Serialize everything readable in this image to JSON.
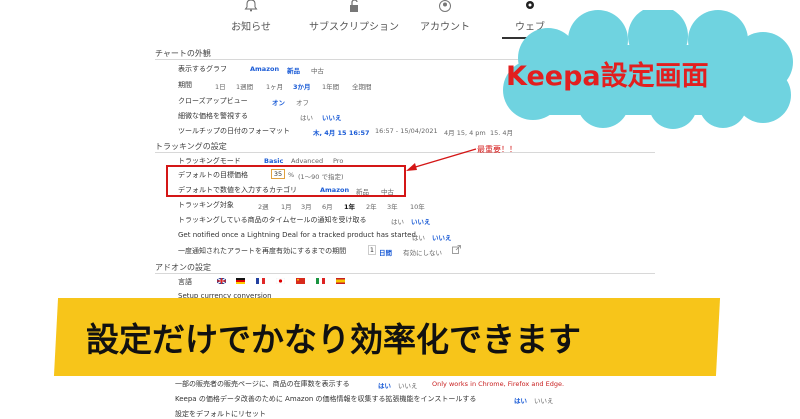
{
  "nav": {
    "items": [
      {
        "label": "お知らせ",
        "icon": "bell-icon"
      },
      {
        "label": "サブスクリプション",
        "icon": "unlock-icon"
      },
      {
        "label": "アカウント",
        "icon": "user-icon"
      },
      {
        "label": "ウェブ",
        "icon": "gear-icon"
      }
    ]
  },
  "chart_appearance": {
    "title": "チャートの外観",
    "graph": {
      "label": "表示するグラフ",
      "options": [
        "Amazon",
        "新品",
        "中古"
      ]
    },
    "period": {
      "label": "期間",
      "options": [
        "1日",
        "1週間",
        "1ヶ月",
        "3か月",
        "1年間",
        "全期間"
      ]
    },
    "closeup": {
      "label": "クローズアップビュー",
      "options": [
        "オン",
        "オフ"
      ]
    },
    "minute": {
      "label": "細微な価格を警視する",
      "options": [
        "はい",
        "いいえ"
      ]
    },
    "tooltip": {
      "label": "ツールチップの日付のフォーマット",
      "options": [
        "木, 4月 15 16:57",
        "16:57 - 15/04/2021",
        "4月 15, 4 pm",
        "15. 4月"
      ]
    }
  },
  "tracking": {
    "title": "トラッキングの設定",
    "mode": {
      "label": "トラッキングモード",
      "options": [
        "Basic",
        "Advanced",
        "Pro"
      ]
    },
    "target_price": {
      "label": "デフォルトの目標価格",
      "value": "35",
      "unit": "%",
      "hint": "(1〜90 で指定)"
    },
    "category": {
      "label": "デフォルトで数値を入力するカテゴリ",
      "options": [
        "Amazon",
        "新品",
        "中古"
      ]
    },
    "target": {
      "label": "トラッキング対象",
      "options": [
        "2週",
        "1月",
        "3月",
        "6月",
        "1年",
        "2年",
        "3年",
        "10年"
      ]
    },
    "timesale": {
      "label": "トラッキングしている商品のタイムセールの通知を受け取る",
      "options": [
        "はい",
        "いいえ"
      ]
    },
    "lightning": {
      "label": "Get notified once a Lightning Deal for a tracked product has started",
      "options": [
        "はい",
        "いいえ"
      ]
    },
    "realert": {
      "label": "一度通知されたアラートを再度有効にするまでの期間",
      "value": "1",
      "unit": "日間",
      "extra": "有効にしない"
    }
  },
  "addons": {
    "title": "アドオンの設定",
    "language": {
      "label": "言語"
    },
    "currency": {
      "label": "Setup currency conversion"
    },
    "stock": {
      "label": "一部の販売者の販売ページに、商品の在庫数を表示する",
      "options": [
        "はい",
        "いいえ"
      ],
      "note": "Only works in Chrome, Firefox and Edge."
    },
    "extension": {
      "label": "Keepa の価格データ改善のために Amazon の価格情報を収集する拡張機能をインストールする",
      "options": [
        "はい",
        "いいえ"
      ]
    },
    "reset": {
      "label": "設定をデフォルトにリセット"
    }
  },
  "annotation": {
    "note": "最重要！！",
    "cloud_title": "Keepa設定画面",
    "banner": "設定だけでかなり効率化できます"
  },
  "colors": {
    "accent": "#1a5bd6",
    "highlight": "#d41616",
    "cloud": "#6fd3e0",
    "banner": "#f7c51a"
  }
}
